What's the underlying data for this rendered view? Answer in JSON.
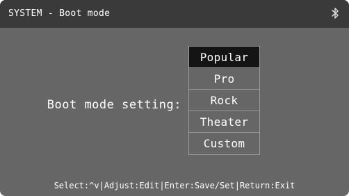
{
  "header": {
    "title": "SYSTEM - Boot mode",
    "icon": "bluetooth-icon"
  },
  "main": {
    "label": "Boot mode setting:",
    "options": [
      "Popular",
      "Pro",
      "Rock",
      "Theater",
      "Custom"
    ],
    "selected_option": "Popular"
  },
  "footer": {
    "select": "Select:^v",
    "adjust": "Adjust:Edit",
    "enter": "Enter:Save/Set",
    "return": "Return:Exit"
  },
  "colors": {
    "screen_bg": "#666666",
    "header_bg": "#3a3a3a",
    "selected_bg": "#141414",
    "text": "#ffffff",
    "border": "#9a9a9a"
  }
}
